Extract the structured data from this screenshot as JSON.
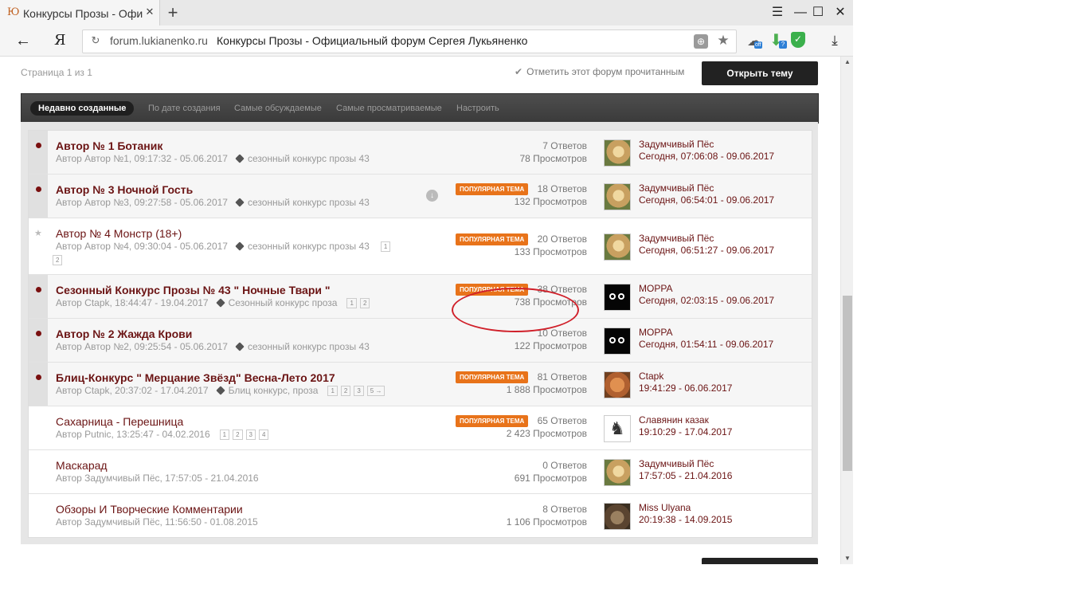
{
  "browser": {
    "tab_title": "Конкурсы Прозы - Официальный форум Сергея Лукьяненко",
    "favicon_glyph": "Ю",
    "tab_close_glyph": "✕",
    "newtab_glyph": "+",
    "window_controls": {
      "menu": "☰",
      "minimize": "—",
      "maximize": "☐",
      "close": "✕"
    },
    "back_glyph": "←",
    "yandex_glyph": "Я",
    "reload_glyph": "↻",
    "url_domain": "forum.lukianenko.ru",
    "url_title": "Конкурсы Прозы - Официальный форум Сергея Лукьяненко",
    "ext_off_label": "off",
    "ext_q_label": "?",
    "ext_shield_glyph": "✓",
    "download_glyph": "⤓",
    "icons": [
      "protect-icon",
      "bookmark-star-icon",
      "extension-off-icon",
      "download-helper-icon",
      "shield-check-icon",
      "download-icon"
    ]
  },
  "forum": {
    "page_info": "Страница 1 из 1",
    "mark_read": "Отметить этот форум прочитанным",
    "new_topic": "Открыть тему",
    "filters": {
      "recent": "Недавно созданные",
      "by_date": "По дате создания",
      "most_discussed": "Самые обсуждаемые",
      "most_viewed": "Самые просматриваемые",
      "customize": "Настроить"
    },
    "popular_label": "ПОПУЛЯРНАЯ ТЕМА",
    "topics": [
      {
        "title": "Автор № 1 Ботаник",
        "meta": "Автор Автор №1, 09:17:32 - 05.06.2017",
        "tag": "сезонный конкурс прозы 43",
        "replies": "7 Ответов",
        "views": "78 Просмотров",
        "last_user": "Задумчивый Пёс",
        "last_time": "Сегодня, 07:06:08 - 09.06.2017"
      },
      {
        "title": "Автор № 3 Ночной Гость",
        "meta": "Автор Автор №3, 09:27:58 - 05.06.2017",
        "tag": "сезонный конкурс прозы 43",
        "replies": "18 Ответов",
        "views": "132 Просмотров",
        "last_user": "Задумчивый Пёс",
        "last_time": "Сегодня, 06:54:01 - 09.06.2017"
      },
      {
        "title": "Автор № 4 Монстр (18+)",
        "meta": "Автор Автор №4, 09:30:04 - 05.06.2017",
        "tag": "сезонный конкурс прозы 43",
        "pages": [
          "1",
          "2"
        ],
        "replies": "20 Ответов",
        "views": "133 Просмотров",
        "last_user": "Задумчивый Пёс",
        "last_time": "Сегодня, 06:51:27 - 09.06.2017"
      },
      {
        "title": "Сезонный Конкурс Прозы № 43 \" Ночные Твари \"",
        "meta": "Автор Ctapk, 18:44:47 - 19.04.2017",
        "tag": "Сезонный конкурс проза",
        "pages": [
          "1",
          "2"
        ],
        "replies": "38 Ответов",
        "views": "738 Просмотров",
        "last_user": "МОРРА",
        "last_time": "Сегодня, 02:03:15 - 09.06.2017"
      },
      {
        "title": "Автор № 2 Жажда Крови",
        "meta": "Автор Автор №2, 09:25:54 - 05.06.2017",
        "tag": "сезонный конкурс прозы 43",
        "replies": "10 Ответов",
        "views": "122 Просмотров",
        "last_user": "МОРРА",
        "last_time": "Сегодня, 01:54:11 - 09.06.2017"
      },
      {
        "title": "Блиц-Конкурс \" Мерцание Звёзд\" Весна-Лето 2017",
        "meta": "Автор Ctapk, 20:37:02 - 17.04.2017",
        "tag": "Блиц конкурс, проза",
        "pages": [
          "1",
          "2",
          "3",
          "5 →"
        ],
        "replies": "81 Ответов",
        "views": "1 888 Просмотров",
        "last_user": "Ctapk",
        "last_time": "19:41:29 - 06.06.2017"
      },
      {
        "title": "Сахарница - Перешница",
        "meta": "Автор Putnic, 13:25:47 - 04.02.2016",
        "pages": [
          "1",
          "2",
          "3",
          "4"
        ],
        "replies": "65 Ответов",
        "views": "2 423 Просмотров",
        "last_user": "Славянин казак",
        "last_time": "19:10:29 - 17.04.2017"
      },
      {
        "title": "Маскарад",
        "meta": "Автор Задумчивый Пёс, 17:57:05 - 21.04.2016",
        "replies": "0 Ответов",
        "views": "691 Просмотров",
        "last_user": "Задумчивый Пёс",
        "last_time": "17:57:05 - 21.04.2016"
      },
      {
        "title": "Обзоры И Творческие Комментарии",
        "meta": "Автор Задумчивый Пёс, 11:56:50 - 01.08.2015",
        "replies": "8 Ответов",
        "views": "1 106 Просмотров",
        "last_user": "Miss Ulyana",
        "last_time": "20:19:38 - 14.09.2015"
      }
    ]
  },
  "colors": {
    "accent": "#6b1414",
    "badge": "#e8731a",
    "annotation": "#d0202a"
  }
}
